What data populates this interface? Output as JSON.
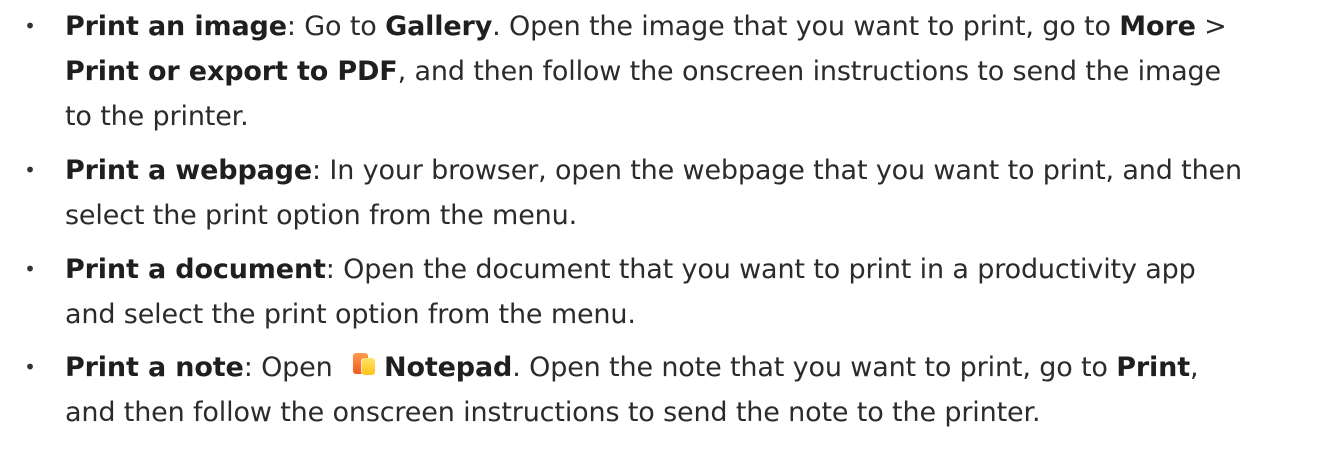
{
  "items": [
    {
      "title": "Print an image",
      "s1": ": Go to ",
      "gallery": "Gallery",
      "s2": ". Open the image that you want to print, go to ",
      "more": "More",
      "s3": " >",
      "print_export": "Print or export to PDF",
      "s4": ", and then follow the onscreen instructions to send the image",
      "s5": "to the printer."
    },
    {
      "title": "Print a webpage",
      "s1": ": In your browser, open the webpage that you want to print, and then",
      "s2": "select the print option from the menu."
    },
    {
      "title": "Print a document",
      "s1": ": Open the document that you want to print in a productivity app",
      "s2": "and select the print option from the menu."
    },
    {
      "title": "Print a note",
      "s1": ": Open ",
      "notepad": "Notepad",
      "s2": ". Open the note that you want to print, go to ",
      "print": "Print",
      "s3": ",",
      "s4": "and then follow the onscreen instructions to send the note to the printer."
    }
  ],
  "bullet_symbol": "•",
  "icons": {
    "notepad": "notepad-app-icon"
  },
  "colors": {
    "text": "#2b2b2b",
    "icon_orange": "#f05a1f",
    "icon_yellow": "#ffc21a"
  }
}
